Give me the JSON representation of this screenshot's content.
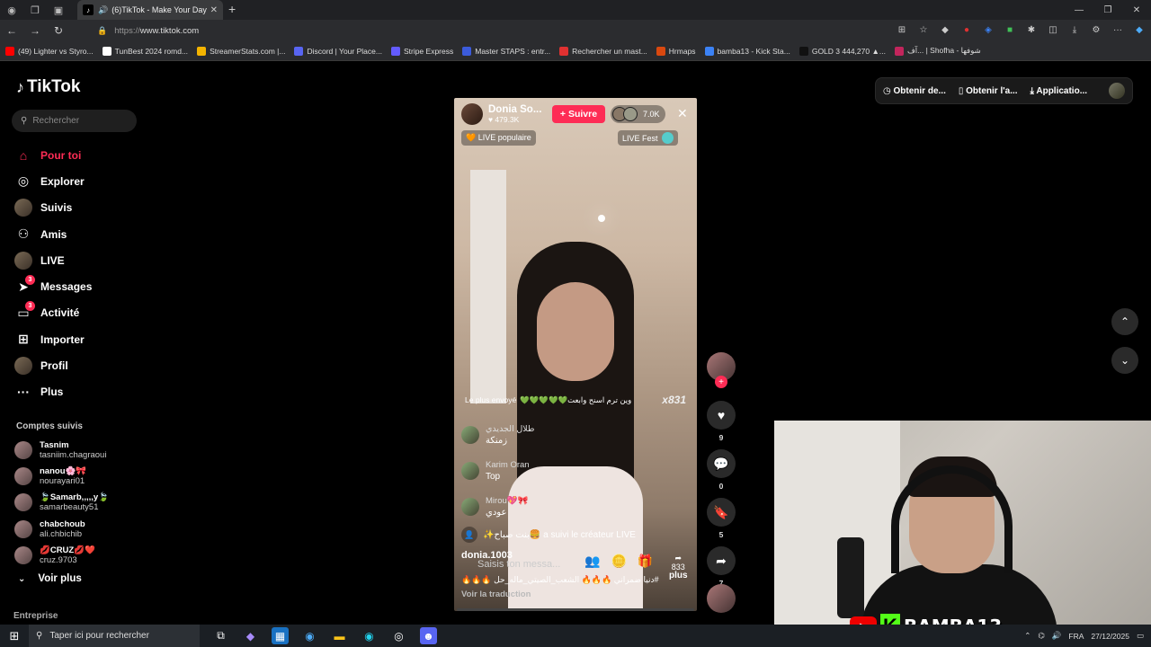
{
  "browser": {
    "tab_title": "(6)TikTok - Make Your Day",
    "url_proto": "https://",
    "url_host": "www.tiktok.com",
    "bookmarks": [
      {
        "label": "(49) Lighter vs Styro...",
        "color": "#ff0000"
      },
      {
        "label": "TunBest 2024 romd...",
        "color": "#ffffff"
      },
      {
        "label": "StreamerStats.com |...",
        "color": "#f4b400"
      },
      {
        "label": "Discord | Your Place...",
        "color": "#5865f2"
      },
      {
        "label": "Stripe Express",
        "color": "#635bff"
      },
      {
        "label": "Master STAPS : entr...",
        "color": "#3b5bdb"
      },
      {
        "label": "Rechercher un mast...",
        "color": "#e03131"
      },
      {
        "label": "Hrmaps",
        "color": "#d9480f"
      },
      {
        "label": "bamba13 - Kick Sta...",
        "color": "#3b82f6"
      },
      {
        "label": "GOLD 3 444,270 ▲...",
        "color": "#111111"
      },
      {
        "label": "آف... | Shofha - شوفها",
        "color": "#c2255c"
      }
    ]
  },
  "sidebar": {
    "logo": "TikTok",
    "search_placeholder": "Rechercher",
    "nav": [
      {
        "label": "Pour toi",
        "icon": "home-icon",
        "glyph": "⌂",
        "active": true,
        "badge": ""
      },
      {
        "label": "Explorer",
        "icon": "compass-icon",
        "glyph": "◎",
        "active": false,
        "badge": ""
      },
      {
        "label": "Suivis",
        "icon": "avatar-icon",
        "glyph": "",
        "active": false,
        "badge": ""
      },
      {
        "label": "Amis",
        "icon": "friends-icon",
        "glyph": "⚇",
        "active": false,
        "badge": ""
      },
      {
        "label": "LIVE",
        "icon": "live-avatar-icon",
        "glyph": "",
        "active": false,
        "badge": ""
      },
      {
        "label": "Messages",
        "icon": "send-icon",
        "glyph": "➤",
        "active": false,
        "badge": "3"
      },
      {
        "label": "Activité",
        "icon": "inbox-icon",
        "glyph": "▭",
        "active": false,
        "badge": "3"
      },
      {
        "label": "Importer",
        "icon": "plus-box-icon",
        "glyph": "⊞",
        "active": false,
        "badge": ""
      },
      {
        "label": "Profil",
        "icon": "profile-avatar-icon",
        "glyph": "",
        "active": false,
        "badge": ""
      },
      {
        "label": "Plus",
        "icon": "more-icon",
        "glyph": "···",
        "active": false,
        "badge": ""
      }
    ],
    "follows_title": "Comptes suivis",
    "follows": [
      {
        "name": "Tasnim",
        "user": "tasniim.chagraoui"
      },
      {
        "name": "nanou🌸🎀",
        "user": "nourayari01"
      },
      {
        "name": "🍃Samarb,,,,,y🍃",
        "user": "samarbeauty51"
      },
      {
        "name": "chabchoub",
        "user": "ali.chbichib"
      },
      {
        "name": "💋CRUZ💋❤️",
        "user": "cruz.9703"
      }
    ],
    "voir_plus": "Voir plus",
    "entreprise": "Entreprise"
  },
  "top_actions": {
    "a1": "Obtenir de...",
    "a2": "Obtenir l'a...",
    "a3": "Applicatio..."
  },
  "live": {
    "host_name": "Donia So...",
    "host_likes": "♥ 479.3K",
    "follow_label": "+ Suivre",
    "viewer_count": "7.0K",
    "badge_popular": "🧡 LIVE populaire",
    "badge_fest": "LIVE Fest",
    "gift_label": "Le plus envoyé",
    "gift_msg": "💚💚💚💚💚وين ترم اسنح وابعت",
    "gift_multiplier": "x831",
    "chat": [
      {
        "name": "طلال الجديدي",
        "text": "زمنكة"
      },
      {
        "name": "Karim Oran",
        "text": "Top"
      },
      {
        "name": "Mirou💖🎀",
        "text": "عودي"
      }
    ],
    "join_text": "✨بنت صباح🍔 a suivi le créateur LIVE",
    "username": "donia.1003",
    "input_placeholder": "Saisis ton messa...",
    "more_count": "833",
    "more_label": "plus",
    "description": "🔥🔥🔥 دنيا ضمراني 🔥🔥🔥 الشعب_الصيتي_ماله_حل#",
    "translate": "Voir la traduction"
  },
  "side_actions": {
    "likes": "9",
    "comments": "0",
    "saves": "5",
    "shares": "7"
  },
  "webcam": {
    "channel": "BAMBA13"
  },
  "taskbar": {
    "search_placeholder": "Taper ici pour rechercher",
    "lang": "FRA",
    "date": "27/12/2025"
  }
}
